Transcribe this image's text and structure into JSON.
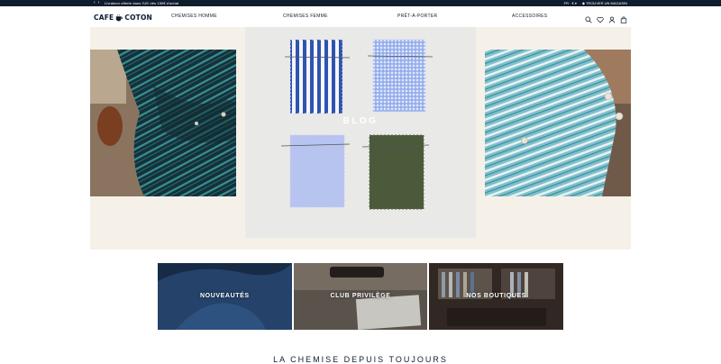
{
  "topbar": {
    "prev_icon": "chevron-left-icon",
    "next_icon": "chevron-right-icon",
    "promo": "Livraison offerte dans l'UE dès 150€ d'achat",
    "locale": "FR · € ▾",
    "store_locator": "◆ TROUVER UN MAGASIN"
  },
  "header": {
    "logo_left": "CAFE",
    "logo_right": "COTON",
    "nav": [
      "CHEMISES HOMME",
      "CHEMISES FEMME",
      "PRÊT-À-PORTER",
      "ACCESSOIRES"
    ],
    "icons": [
      "search-icon",
      "heart-icon",
      "user-icon",
      "bag-icon"
    ]
  },
  "hero": {
    "center_label": "BLOG"
  },
  "tiles": [
    {
      "label": "NOUVEAUTÉS"
    },
    {
      "label": "CLUB PRIVILÈGE"
    },
    {
      "label": "NOS BOUTIQUES"
    }
  ],
  "section_title_cut": "LA CHEMISE DEPUIS TOUJOURS",
  "colors": {
    "navy": "#0f1c2e",
    "cream": "#f5f1e8",
    "white": "#ffffff"
  }
}
